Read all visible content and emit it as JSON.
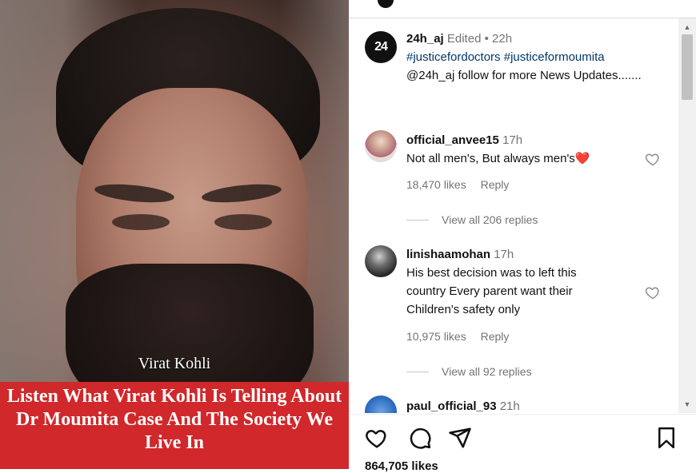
{
  "video": {
    "name_caption": "Virat Kohli",
    "headline": "Listen What Virat Kohli Is Telling About Dr Moumita Case And The Society We Live In",
    "headline_color": "#d0282b"
  },
  "post": {
    "author": {
      "avatar_text": "24",
      "username": "24h_aj",
      "edited_label": "Edited",
      "separator": "•",
      "time": "22h",
      "caption_hashtags": "#justicefordoctors #justiceformoumita",
      "caption_text": "@24h_aj follow for more News Updates......."
    },
    "comments": [
      {
        "username": "official_anvee15",
        "time": "17h",
        "text": "Not all men's, But always men's❤️",
        "likes": "18,470 likes",
        "reply_label": "Reply",
        "view_replies": "View all 206 replies",
        "avatar_icon": "profile-photo"
      },
      {
        "username": "linishaamohan",
        "time": "17h",
        "text": "His best decision was to left this country Every parent want their Children's safety only",
        "likes": "10,975 likes",
        "reply_label": "Reply",
        "view_replies": "View all 92 replies",
        "avatar_icon": "profile-photo"
      },
      {
        "username": "paul_official_93",
        "time": "21h",
        "avatar_icon": "profile-photo"
      }
    ],
    "actions": {
      "icons": [
        "heart-icon",
        "comment-icon",
        "share-icon",
        "bookmark-icon"
      ]
    },
    "likes_count": "864,705 likes"
  }
}
